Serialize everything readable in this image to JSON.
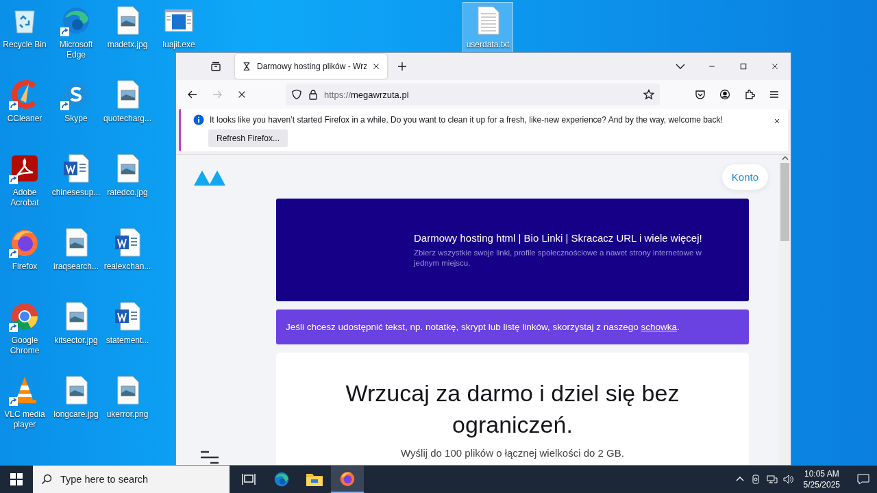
{
  "desktop_icons": [
    {
      "label": "Recycle Bin",
      "kind": "recycle",
      "shortcut": false,
      "selected": false
    },
    {
      "label": "CCleaner",
      "kind": "ccleaner",
      "shortcut": true,
      "selected": false
    },
    {
      "label": "Adobe Acrobat",
      "kind": "pdf",
      "shortcut": true,
      "selected": false
    },
    {
      "label": "Firefox",
      "kind": "firefox",
      "shortcut": true,
      "selected": false
    },
    {
      "label": "Google Chrome",
      "kind": "chrome",
      "shortcut": true,
      "selected": false
    },
    {
      "label": "VLC media player",
      "kind": "vlc",
      "shortcut": true,
      "selected": false
    },
    {
      "label": "Microsoft Edge",
      "kind": "edge",
      "shortcut": true,
      "selected": false
    },
    {
      "label": "Skype",
      "kind": "skype",
      "shortcut": true,
      "selected": false
    },
    {
      "label": "chinesesup...",
      "kind": "word",
      "shortcut": false,
      "selected": false
    },
    {
      "label": "iraqsearch...",
      "kind": "image",
      "shortcut": false,
      "selected": false
    },
    {
      "label": "kitsector.jpg",
      "kind": "image",
      "shortcut": false,
      "selected": false
    },
    {
      "label": "longcare.jpg",
      "kind": "image",
      "shortcut": false,
      "selected": false
    },
    {
      "label": "madetx.jpg",
      "kind": "image",
      "shortcut": false,
      "selected": false
    },
    {
      "label": "quotecharg...",
      "kind": "image",
      "shortcut": false,
      "selected": false
    },
    {
      "label": "ratedco.jpg",
      "kind": "image",
      "shortcut": false,
      "selected": false
    },
    {
      "label": "realexchan...",
      "kind": "word",
      "shortcut": false,
      "selected": false
    },
    {
      "label": "statement...",
      "kind": "word",
      "shortcut": false,
      "selected": false
    },
    {
      "label": "ukerror.png",
      "kind": "image",
      "shortcut": false,
      "selected": false
    },
    {
      "label": "luajit.exe",
      "kind": "exe",
      "shortcut": false,
      "selected": false
    }
  ],
  "loose_icon": {
    "label": "userdata.txt",
    "kind": "text",
    "shortcut": false,
    "selected": true
  },
  "browser": {
    "tabs": [
      {
        "title": "Darmowy hosting plików - Wrz",
        "selected": true
      }
    ],
    "back": {
      "disabled": false
    },
    "forward": {
      "disabled": true
    },
    "url_scheme": "https://",
    "url_host": "megawrzuta.pl",
    "notice": {
      "text": "It looks like you haven’t started Firefox in a while. Do you want to clean it up for a fresh, like-new experience? And by the way, welcome back!",
      "button": "Refresh Firefox..."
    },
    "page": {
      "account_button": "Konto",
      "hero": {
        "title": "Darmowy hosting html | Bio Linki | Skracacz URL i wiele więcej!",
        "subtitle": "Zbierz wszystkie swoje linki, profile społecznościowe a nawet strony internetowe w jednym miejscu."
      },
      "banner": {
        "text": "Jeśli chcesz udostępnić tekst, np. notatkę, skrypt lub listę linków, skorzystaj z naszego ",
        "link": "schowka",
        "tail": "."
      },
      "card": {
        "heading": "Wrzucaj za darmo i dziel się bez ograniczeń.",
        "subtitle": "Wyślij do 100 plików o łącznej wielkości do 2 GB."
      }
    }
  },
  "taskbar": {
    "search_placeholder": "Type here to search",
    "apps": [
      {
        "kind": "taskview",
        "selected": false
      },
      {
        "kind": "edge",
        "selected": false
      },
      {
        "kind": "explorer",
        "selected": false
      },
      {
        "kind": "firefox",
        "selected": true
      }
    ],
    "time": "10:05 AM",
    "date": "5/25/2025"
  }
}
